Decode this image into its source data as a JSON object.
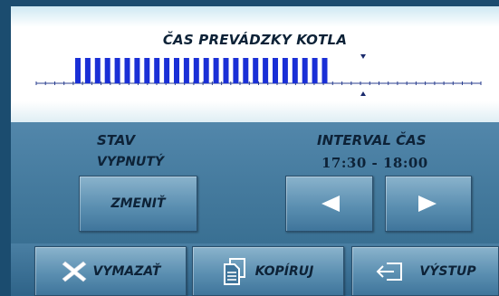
{
  "header": {
    "title": "ČAS PREVÁDZKY KOTLA"
  },
  "chart_data": {
    "type": "bar",
    "bar_count": 26,
    "marker": "current-time"
  },
  "state": {
    "label": "STAV",
    "value": "VYPNUTÝ",
    "change_button": "ZMENIŤ"
  },
  "interval": {
    "label": "INTERVAL ČAS",
    "value": "17:30  -  18:00",
    "prev_icon": "left-triangle-icon",
    "next_icon": "right-triangle-icon"
  },
  "toolbar": {
    "delete_label": "VYMAZAŤ",
    "delete_icon": "x-icon",
    "copy_label": "KOPÍRUJ",
    "copy_icon": "copy-document-icon",
    "exit_label": "VÝSTUP",
    "exit_icon": "exit-icon"
  },
  "colors": {
    "bar_color": "#1a2fd6",
    "text_color": "#0d2237",
    "accent_white": "#ffffff"
  }
}
